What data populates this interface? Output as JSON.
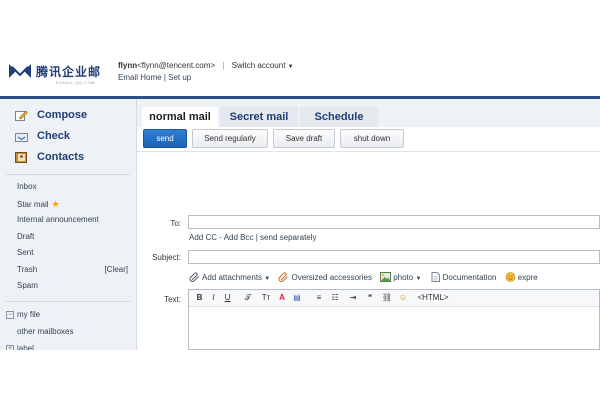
{
  "brand": {
    "logo_text": "腾讯企业邮",
    "logo_sub": "EXMAIL.QQ.COM",
    "colors": {
      "accent": "#2b4f86",
      "primary_button": "#1e62b4",
      "sidebar_bg": "#eef1f5",
      "star": "#f0a500"
    }
  },
  "header": {
    "user_name": "flynn",
    "user_email": "<flynn@tencent.com>",
    "separator": "|",
    "switch_account": "Switch account",
    "switch_caret_icon": "caret-down-icon",
    "email_home": "Email Home",
    "links_sep": "|",
    "set_up": "Set up"
  },
  "sidebar": {
    "actions": [
      {
        "label": "Compose",
        "icon": "compose-icon"
      },
      {
        "label": "Check",
        "icon": "inbox-check-icon"
      },
      {
        "label": "Contacts",
        "icon": "contacts-icon"
      }
    ],
    "folders": [
      {
        "label": "Inbox"
      },
      {
        "label": "Star mail",
        "icon": "star-icon"
      },
      {
        "label": "Internal announcement"
      },
      {
        "label": "Draft"
      },
      {
        "label": "Sent"
      },
      {
        "label": "Trash",
        "action": "[Clear]"
      },
      {
        "label": "Spam"
      }
    ],
    "groups": [
      {
        "label": "my file",
        "box": "⊟"
      },
      {
        "label": "other mailboxes"
      },
      {
        "label": "label",
        "box": "⊞"
      }
    ]
  },
  "tabs": [
    {
      "label": "normal mail",
      "active": true
    },
    {
      "label": "Secret mail",
      "active": false
    },
    {
      "label": "Schedule",
      "active": false
    }
  ],
  "toolbar": {
    "send": "send",
    "send_regularly": "Send regularly",
    "save_draft": "Save draft",
    "shut_down": "shut down"
  },
  "compose": {
    "to_label": "To:",
    "to_value": "",
    "add_cc": "Add CC",
    "dash": "-",
    "add_bcc": "Add Bcc",
    "pipe": "|",
    "send_separately": "send separately",
    "subject_label": "Subject:",
    "subject_value": "",
    "attach": {
      "add_attachments": "Add attachments",
      "oversized": "Oversized accessories",
      "photo": "photo",
      "documentation": "Documentation",
      "expression": "expre"
    },
    "text_label": "Text:",
    "editor_buttons": [
      "B",
      "I",
      "U",
      "𝒯",
      "Tт",
      "A",
      "▤",
      "≡",
      "☷",
      "⇥",
      "❝",
      "⛓",
      "☺",
      "<HTML>"
    ]
  }
}
